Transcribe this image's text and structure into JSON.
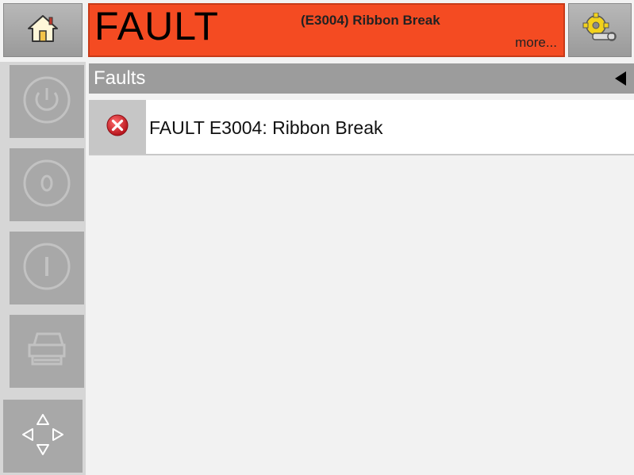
{
  "status": {
    "title": "FAULT",
    "message": "(E3004) Ribbon Break",
    "more_link": "more...",
    "banner_color": "#f44b22"
  },
  "icons": {
    "home": "home-icon",
    "settings": "settings-gear-icon",
    "power": "power-icon",
    "stop": "stop-icon",
    "start": "start-icon",
    "print": "printer-icon",
    "navigate": "navigation-arrows-icon",
    "fault": "error-x-icon"
  },
  "panel": {
    "title": "Faults",
    "faults": [
      {
        "label": "FAULT E3004: Ribbon Break",
        "severity_color": "#d9252a"
      }
    ]
  }
}
